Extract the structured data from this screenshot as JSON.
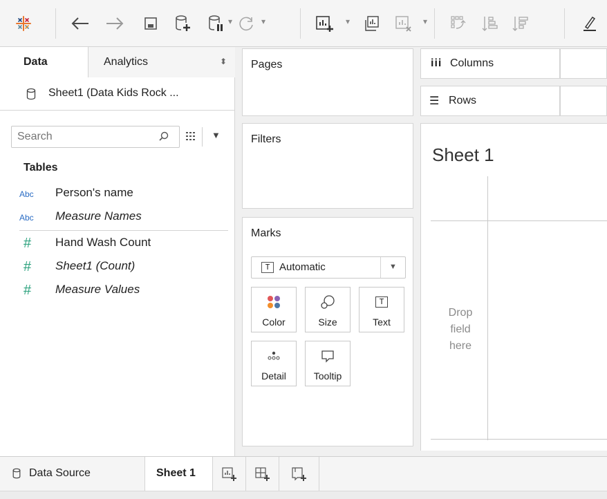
{
  "toolbar": {
    "icons": [
      "tableau-logo-icon",
      "back-arrow-icon",
      "forward-arrow-icon",
      "save-icon",
      "add-datasource-icon",
      "pause-updates-icon",
      "refresh-icon",
      "new-worksheet-icon",
      "duplicate-sheet-icon",
      "clear-sheet-icon",
      "swap-icon",
      "sort-ascending-icon",
      "sort-descending-icon",
      "highlight-icon"
    ]
  },
  "data_pane": {
    "tab_data": "Data",
    "tab_analytics": "Analytics",
    "source_name": "Sheet1 (Data Kids Rock ...",
    "search_placeholder": "Search",
    "tables_heading": "Tables",
    "dimensions": [
      {
        "type": "Abc",
        "name": "Person's name",
        "italic": false
      },
      {
        "type": "Abc",
        "name": "Measure Names",
        "italic": true
      }
    ],
    "measures": [
      {
        "type": "#",
        "name": "Hand Wash Count",
        "italic": false
      },
      {
        "type": "#",
        "name": "Sheet1 (Count)",
        "italic": true
      },
      {
        "type": "#",
        "name": "Measure Values",
        "italic": true
      }
    ]
  },
  "shelves": {
    "pages": "Pages",
    "filters": "Filters",
    "marks": "Marks",
    "marks_type": "Automatic",
    "mark_cards": [
      "Color",
      "Size",
      "Text",
      "Detail",
      "Tooltip"
    ],
    "columns": "Columns",
    "rows": "Rows"
  },
  "view": {
    "sheet_title": "Sheet 1",
    "drop_hint_1": "Drop",
    "drop_hint_2": "field",
    "drop_hint_3": "here"
  },
  "tabs_bar": {
    "data_source": "Data Source",
    "sheet": "Sheet 1"
  },
  "colors": {
    "dimension_blue": "#2a6cc4",
    "measure_green": "#2fa37f",
    "toolbar_blue": "#3d6fb5"
  }
}
